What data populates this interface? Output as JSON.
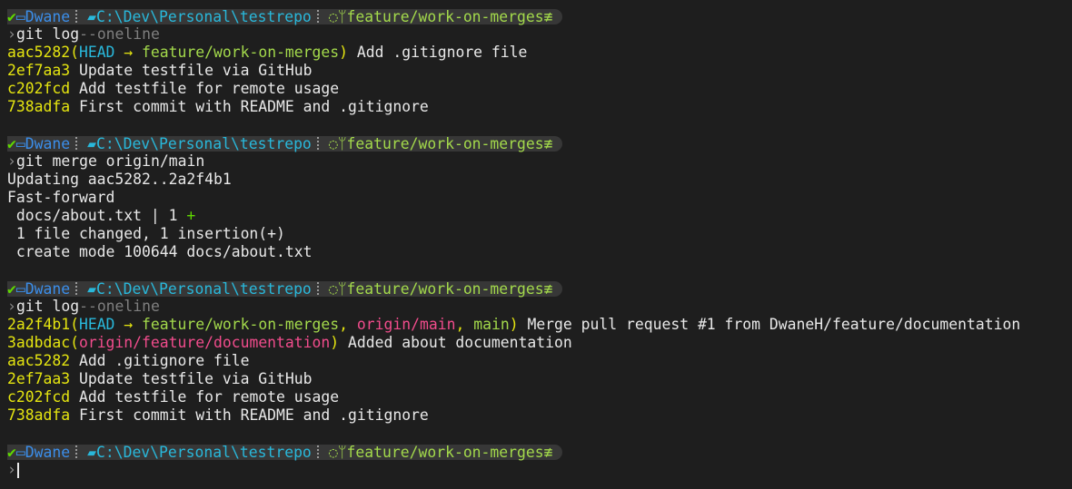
{
  "prompt": {
    "check_glyph": "✔",
    "monitor_glyph": "🖵",
    "user": "Dwane",
    "folder_glyph": "▬",
    "path": "C:\\Dev\\Personal\\testrepo",
    "github_glyph": "ɷ",
    "branch_glyph": "⎇",
    "branch": "feature/work-on-merges",
    "status_glyph": "≢",
    "chevron": "›"
  },
  "blocks": [
    {
      "command": {
        "main": "git log",
        "arg": "--oneline"
      },
      "log": [
        {
          "hash": "aac5282",
          "refs_open": "(",
          "head": "HEAD",
          "arrow": " → ",
          "branch": "feature/work-on-merges",
          "refs_close": ")",
          "message": " Add .gitignore file"
        },
        {
          "hash": "2ef7aa3",
          "message": " Update testfile via GitHub"
        },
        {
          "hash": "c202fcd",
          "message": " Add testfile for remote usage"
        },
        {
          "hash": "738adfa",
          "message": " First commit with README and .gitignore"
        }
      ]
    },
    {
      "command": {
        "main": "git merge origin/main",
        "arg": ""
      },
      "output": [
        "Updating aac5282..2a2f4b1",
        "Fast-forward",
        " docs/about.txt | 1 ",
        " 1 file changed, 1 insertion(+)",
        " create mode 100644 docs/about.txt"
      ],
      "plus": "+"
    },
    {
      "command": {
        "main": "git log",
        "arg": "--oneline"
      },
      "log": [
        {
          "hash": "2a2f4b1",
          "refs_open": "(",
          "head": "HEAD",
          "arrow": " → ",
          "branch": "feature/work-on-merges",
          "comma1": ", ",
          "remote": "origin/main",
          "comma2": ", ",
          "branch2": "main",
          "refs_close": ")",
          "message": " Merge pull request #1 from DwaneH/feature/documentation"
        },
        {
          "hash": "3adbdac",
          "refs_open": "(",
          "remote": "origin/feature/documentation",
          "refs_close": ")",
          "message": " Added about documentation"
        },
        {
          "hash": "aac5282",
          "message": " Add .gitignore file"
        },
        {
          "hash": "2ef7aa3",
          "message": " Update testfile via GitHub"
        },
        {
          "hash": "c202fcd",
          "message": " Add testfile for remote usage"
        },
        {
          "hash": "738adfa",
          "message": " First commit with README and .gitignore"
        }
      ]
    }
  ],
  "colors": {
    "background": "#1e1e1e",
    "prompt_bg": "#373737",
    "hash": "#e5e510",
    "head": "#29b8db",
    "branch": "#a3d94b",
    "remote": "#f14c8c",
    "user": "#3b8eea"
  }
}
